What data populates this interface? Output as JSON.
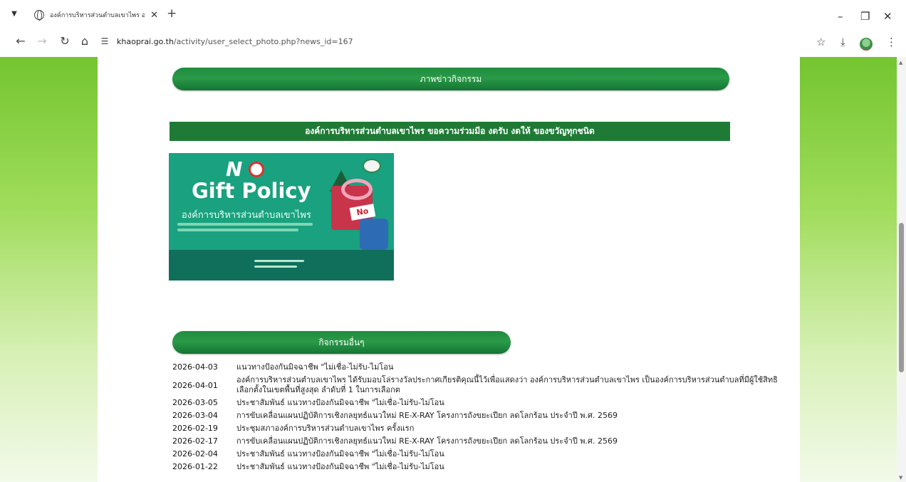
{
  "browser": {
    "tab_title": "องค์การบริหารส่วนตำบลเขาไพร อ.",
    "url_host": "khaoprai.go.th",
    "url_path": "/activity/user_select_photo.php?news_id=167",
    "icons": [
      "tab-list-icon",
      "globe-icon",
      "close-icon",
      "new-tab-icon",
      "minimize-icon",
      "restore-icon",
      "close-window-icon",
      "back-icon",
      "forward-icon",
      "reload-icon",
      "home-icon",
      "site-settings-icon",
      "star-icon",
      "download-icon",
      "profile-icon",
      "menu-icon"
    ]
  },
  "page": {
    "photo_header": "ภาพข่าวกิจกรรม",
    "banner": "องค์การบริหารส่วนตำบลเขาไพร ขอความร่วมมือ งดรับ งดให้ ของขวัญทุกชนิด",
    "poster": {
      "no_text": "N",
      "title": "Gift Policy",
      "org": "องค์การบริหารส่วนตำบลเขาไพร",
      "sign": "No"
    },
    "other_header": "กิจกรรมอื่นๆ",
    "activities": [
      {
        "date": "2026-04-03",
        "text": "แนวทางป้องกันมิจฉาชีพ \"ไม่เชื่อ-ไม่รับ-ไม่โอน"
      },
      {
        "date": "2026-04-01",
        "text": "องค์การบริหารส่วนตำบลเขาไพร ได้รับมอบโล่รางวัลประกาศเกียรติคุณนี้ไว้เพื่อแสดงว่า องค์การบริหารส่วนตำบลเขาไพร เป็นองค์การบริหารส่วนตำบลที่มีผู้ใช้สิทธิเลือกตั้งในเขตพื้นที่สูงสุด ลำดับที่ 1 ในการเลือกต"
      },
      {
        "date": "2026-03-05",
        "text": "ประชาสัมพันธ์ แนวทางป้องกันมิจฉาชีพ \"ไม่เชื่อ-ไม่รับ-ไม่โอน"
      },
      {
        "date": "2026-03-04",
        "text": "การขับเคลื่อนแผนปฏิบัติการเชิงกลยุทธ์แนวใหม่ RE-X-RAY โครงการถังขยะเปียก ลดโลกร้อน ประจำปี พ.ศ. 2569"
      },
      {
        "date": "2026-02-19",
        "text": "ประชุมสภาองค์การบริหารส่วนตำบลเขาไพร ครั้งแรก"
      },
      {
        "date": "2026-02-17",
        "text": "การขับเคลื่อนแผนปฏิบัติการเชิงกลยุทธ์แนวใหม่ RE-X-RAY โครงการถังขยะเปียก ลดโลกร้อน ประจำปี พ.ศ. 2569"
      },
      {
        "date": "2026-02-04",
        "text": "ประชาสัมพันธ์ แนวทางป้องกันมิจฉาชีพ \"ไม่เชื่อ-ไม่รับ-ไม่โอน"
      },
      {
        "date": "2026-01-22",
        "text": "ประชาสัมพันธ์ แนวทางป้องกันมิจฉาชีพ \"ไม่เชื่อ-ไม่รับ-ไม่โอน"
      }
    ]
  },
  "colors": {
    "accent_green": "#1f7a35",
    "side_green": "#74c531"
  }
}
